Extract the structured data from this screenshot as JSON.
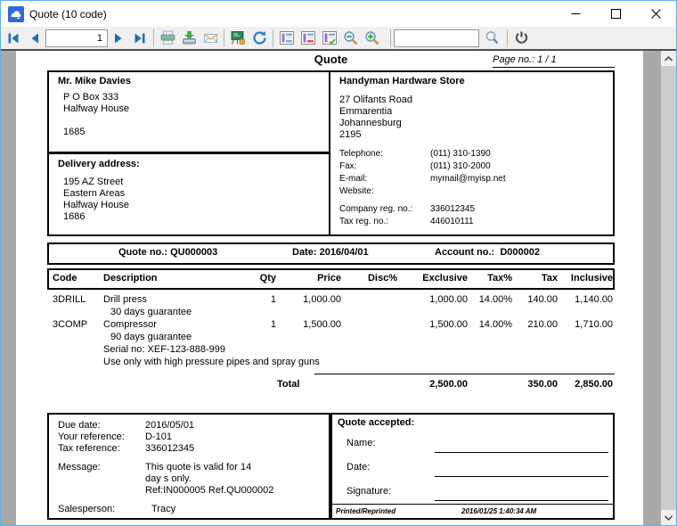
{
  "colors": {
    "accent_blue": "#1d70b8",
    "window_border": "#5fb2e8",
    "preview_bg": "#a9a9a9",
    "toolbar_bg": "#f0f0f0"
  },
  "window": {
    "title": "Quote (10 code)"
  },
  "toolbar": {
    "page_value": "1",
    "search_value": "",
    "icons": [
      "first-page",
      "previous-page",
      "next-page",
      "last-page",
      "print",
      "export",
      "email",
      "design",
      "refresh",
      "layout-option-1",
      "layout-option-2",
      "layout-option-3",
      "zoom-out",
      "zoom-in",
      "search",
      "exit"
    ]
  },
  "doc": {
    "title": "Quote",
    "page_no_label": "Page no.:",
    "page_no_value": "1  /  1",
    "customer": {
      "name": "Mr. Mike Davies",
      "lines": [
        "P O Box 333",
        "Halfway House",
        "",
        "1685"
      ]
    },
    "delivery": {
      "label": "Delivery address:",
      "lines": [
        "195 AZ Street",
        "Eastern Areas",
        "Halfway House",
        "1686"
      ]
    },
    "supplier": {
      "name": "Handyman Hardware Store",
      "lines": [
        "27 Olifants Road",
        "Emmarentia",
        "Johannesburg",
        "2195"
      ],
      "contact": [
        {
          "label": "Telephone:",
          "value": "(011) 310-1390"
        },
        {
          "label": "Fax:",
          "value": "(011) 310-2000"
        },
        {
          "label": "E-mail:",
          "value": "mymail@myisp.net"
        },
        {
          "label": "Website:",
          "value": ""
        }
      ],
      "registration": [
        {
          "label": "Company reg. no.:",
          "value": "336012345"
        },
        {
          "label": "Tax reg. no.:",
          "value": "446010111"
        }
      ]
    },
    "info": {
      "quote_no_label": "Quote no.:",
      "quote_no": "QU000003",
      "date_label": "Date:",
      "date": "2016/04/01",
      "account_label": "Account no.:",
      "account": "D000002"
    },
    "table": {
      "headers": {
        "code": "Code",
        "description": "Description",
        "qty": "Qty",
        "price": "Price",
        "disc": "Disc%",
        "exclusive": "Exclusive",
        "tax_pct": "Tax%",
        "tax": "Tax",
        "inclusive": "Inclusive"
      },
      "rows": [
        {
          "code": "3DRILL",
          "description": "Drill press",
          "qty": "1",
          "price": "1,000.00",
          "disc": "",
          "exclusive": "1,000.00",
          "tax_pct": "14.00%",
          "tax": "140.00",
          "inclusive": "1,140.00",
          "notes": [
            "30 days guarantee"
          ]
        },
        {
          "code": "3COMP",
          "description": "Compressor",
          "qty": "1",
          "price": "1,500.00",
          "disc": "",
          "exclusive": "1,500.00",
          "tax_pct": "14.00%",
          "tax": "210.00",
          "inclusive": "1,710.00",
          "notes": [
            "90 days guarantee",
            "Serial no: XEF-123-888-999",
            "Use only with high pressure pipes and spray guns"
          ]
        }
      ],
      "total": {
        "label": "Total",
        "exclusive": "2,500.00",
        "tax": "350.00",
        "inclusive": "2,850.00"
      }
    },
    "details": {
      "rows": [
        {
          "label": "Due date:",
          "value": "2016/05/01"
        },
        {
          "label": "Your reference:",
          "value": "D-101"
        },
        {
          "label": "Tax reference:",
          "value": "336012345"
        }
      ],
      "message_label": "Message:",
      "message_lines": [
        "This quote is valid for 14",
        "day s only.",
        "Ref:IN000005 Ref.QU000002"
      ],
      "salesperson_label": "Salesperson:",
      "salesperson": "Tracy"
    },
    "accept": {
      "title": "Quote accepted:",
      "name_label": "Name:",
      "date_label": "Date:",
      "signature_label": "Signature:",
      "printed_label": "Printed/Reprinted",
      "printed_at": "2016/01/25 1:40:34 AM"
    }
  }
}
